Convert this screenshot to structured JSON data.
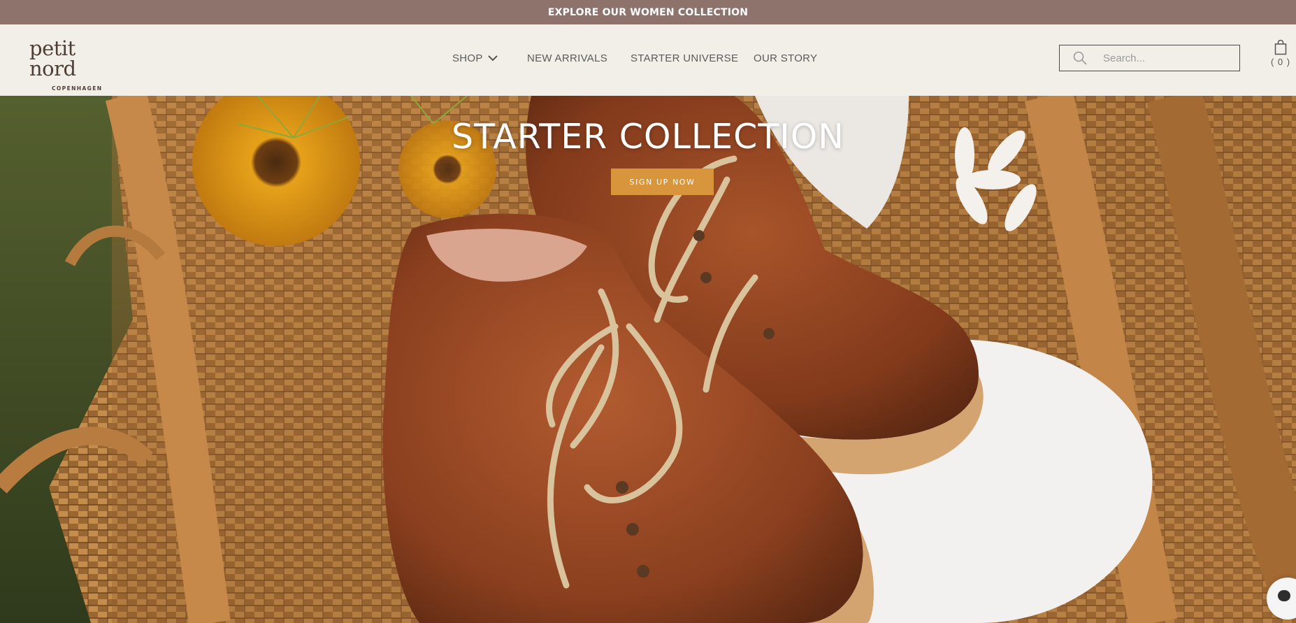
{
  "announcement": {
    "text": "EXPLORE OUR WOMEN COLLECTION"
  },
  "brand": {
    "name": "petit nord",
    "sub": "COPENHAGEN"
  },
  "nav": {
    "shop": "SHOP",
    "new_arrivals": "NEW ARRIVALS",
    "starter_universe": "STARTER UNIVERSE",
    "our_story": "OUR STORY"
  },
  "search": {
    "placeholder": "Search..."
  },
  "cart": {
    "count_label": "( 0 )"
  },
  "hero": {
    "title": "STARTER COLLECTION",
    "cta": "SIGN UP NOW",
    "colors": {
      "button": "#d8953c",
      "announce_bar": "#8d736b",
      "header_bg": "#f1efe8"
    }
  },
  "icons": {
    "search": "search-icon",
    "chevron": "chevron-down-icon",
    "cart": "shopping-bag-icon",
    "chat": "chat-icon"
  }
}
